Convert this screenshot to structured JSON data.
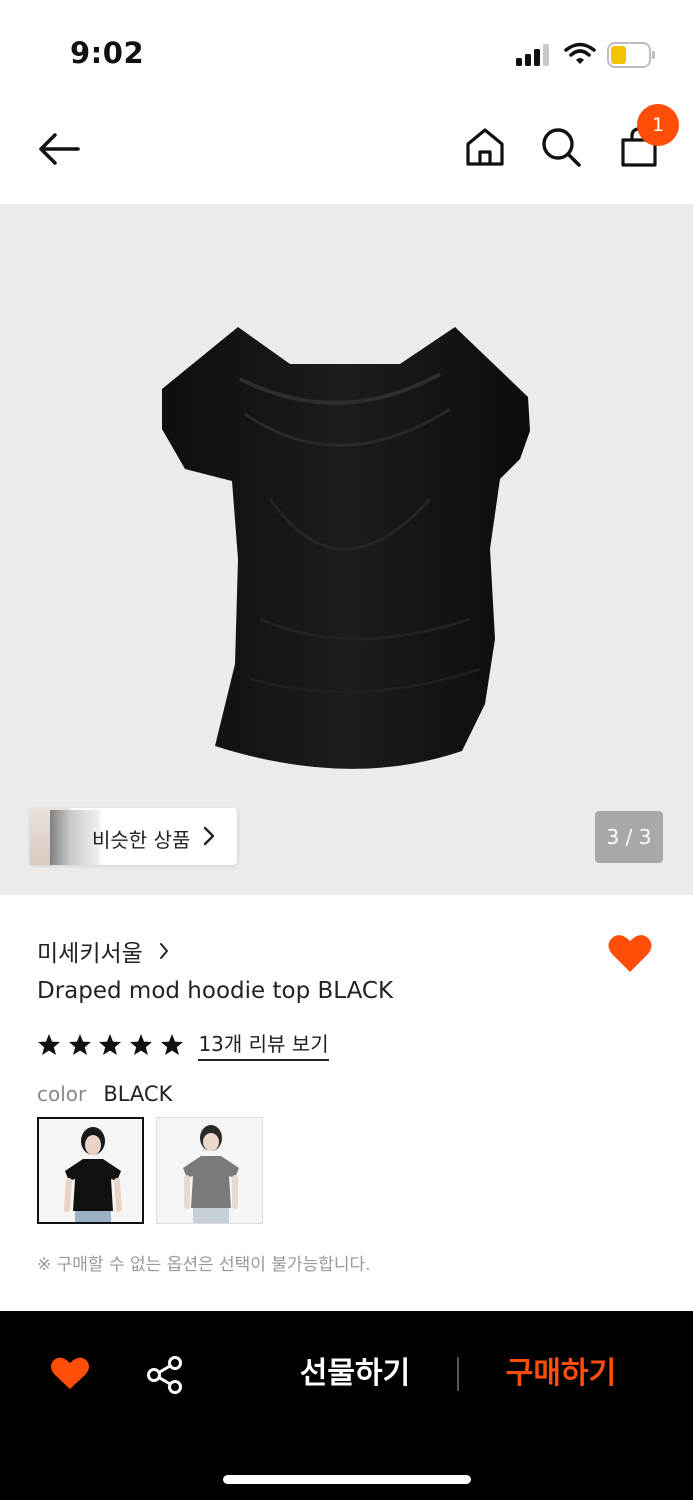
{
  "status_bar": {
    "time": "9:02"
  },
  "header": {
    "cart_count": "1"
  },
  "gallery": {
    "similar_label": "비슷한 상품",
    "page_indicator": "3 / 3"
  },
  "product": {
    "brand": "미세키서울",
    "title": "Draped mod hoodie top BLACK",
    "rating": 5,
    "review_link": "13개 리뷰 보기",
    "option_label": "color",
    "option_value": "BLACK",
    "notice": "※ 구매할 수 없는 옵션은 선택이 불가능합니다."
  },
  "bottom_bar": {
    "gift_label": "선물하기",
    "buy_label": "구매하기"
  },
  "colors": {
    "accent": "#ff4e0a",
    "bottom_bar_bg": "#000000",
    "gallery_bg": "#ebebeb"
  }
}
